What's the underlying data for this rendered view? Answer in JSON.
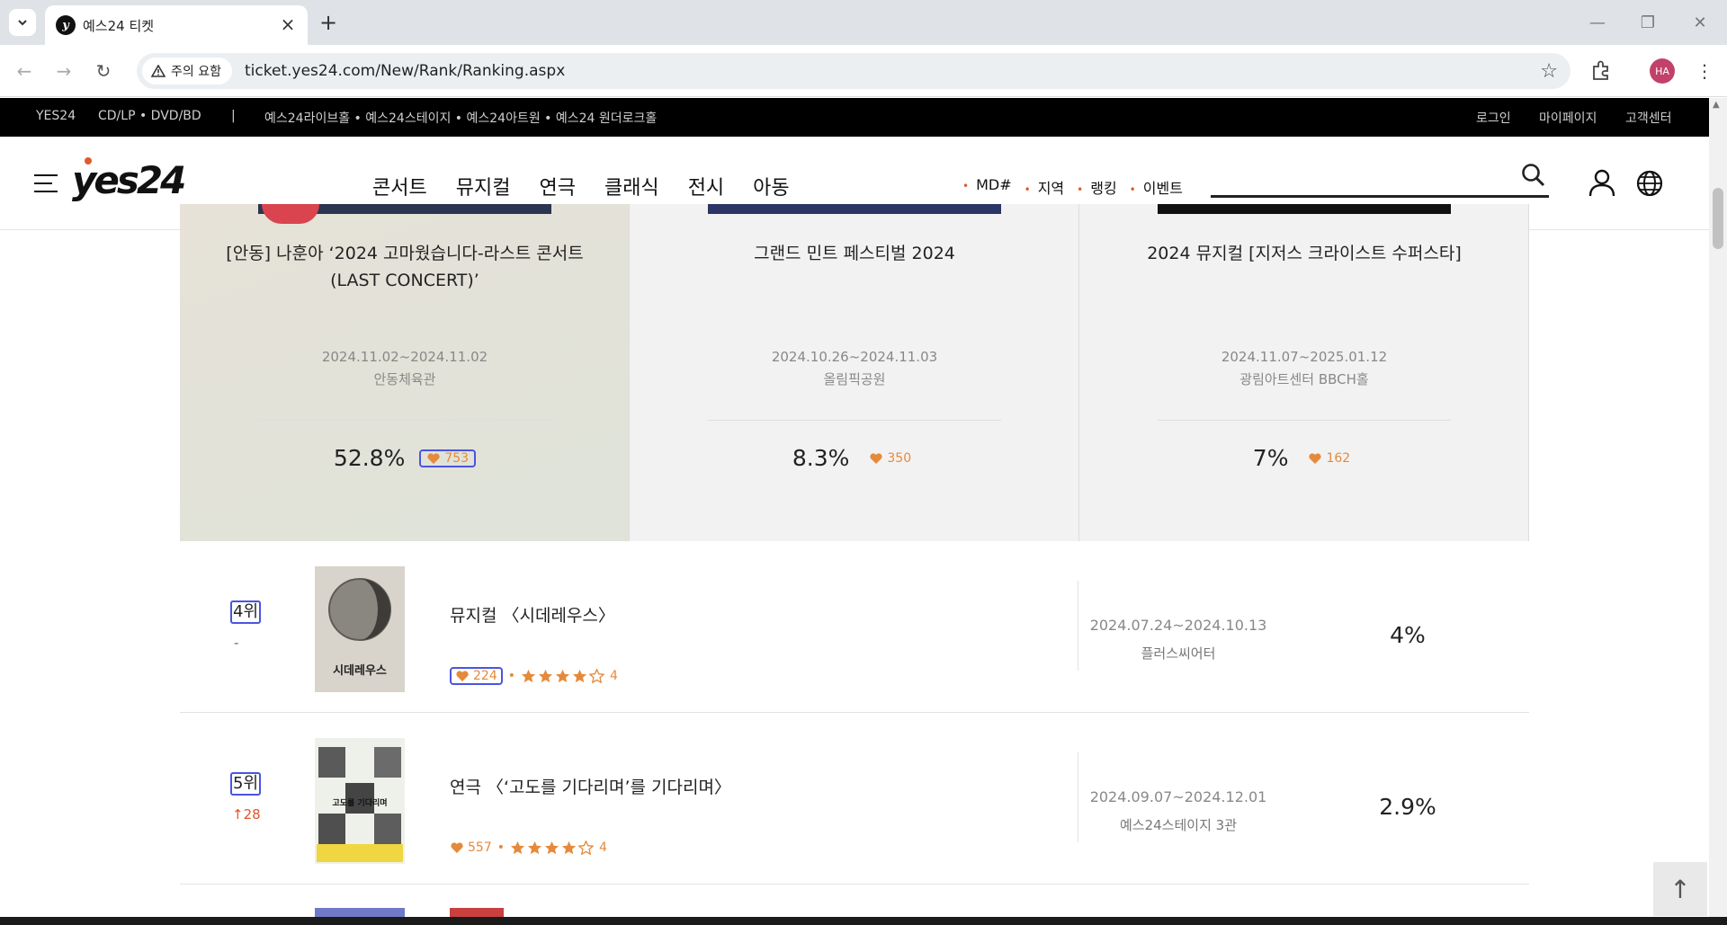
{
  "browser": {
    "tab_title": "예스24 티켓",
    "security_label": "주의 요함",
    "url": "ticket.yes24.com/New/Rank/Ranking.aspx",
    "profile_initials": "HA"
  },
  "topstrip": {
    "yes24": "YES24",
    "cdlp": "CD/LP • DVD/BD",
    "separator": "|",
    "halls": "예스24라이브홀 • 예스24스테이지 • 예스24아트원 • 예스24 원더로크홀",
    "login": "로그인",
    "mypage": "마이페이지",
    "support": "고객센터"
  },
  "header": {
    "logo": "yes24",
    "gnb": [
      "콘서트",
      "뮤지컬",
      "연극",
      "클래식",
      "전시",
      "아동"
    ],
    "subnav": [
      "MD#",
      "지역",
      "랭킹",
      "이벤트"
    ]
  },
  "top_cards": [
    {
      "title": "[안동] 나훈아 ‘2024 고마웠습니다-라스트 콘서트(LAST CONCERT)’",
      "dates": "2024.11.02~2024.11.02",
      "venue": "안동체육관",
      "percent": "52.8%",
      "likes": "753",
      "poster_color": "#2c3550"
    },
    {
      "title": "그랜드 민트 페스티벌 2024",
      "dates": "2024.10.26~2024.11.03",
      "venue": "올림픽공원",
      "percent": "8.3%",
      "likes": "350",
      "poster_color": "#2b3566"
    },
    {
      "title": "2024 뮤지컬 [지저스 크라이스트 수퍼스타]",
      "dates": "2024.11.07~2025.01.12",
      "venue": "광림아트센터 BBCH홀",
      "percent": "7%",
      "likes": "162",
      "poster_color": "#111111"
    }
  ],
  "rows": [
    {
      "rank": "4위",
      "change": "-",
      "title": "뮤지컬 〈시데레우스〉",
      "likes": "224",
      "rating": "4",
      "rating_value": 4,
      "dates": "2024.07.24~2024.10.13",
      "venue": "플러스씨어터",
      "percent": "4%",
      "poster_text": "시데레우스"
    },
    {
      "rank": "5위",
      "change": "↑28",
      "title": "연극 〈‘고도를 기다리며’를 기다리며〉",
      "likes": "557",
      "rating": "4",
      "rating_value": 4,
      "dates": "2024.09.07~2024.12.01",
      "venue": "예스24스테이지 3관",
      "percent": "2.9%",
      "poster_text": "고도를 기다리며"
    }
  ],
  "colors": {
    "accent": "#e58a3c",
    "rank_up": "#e0552a",
    "highlight_outline": "#4a55e0"
  }
}
